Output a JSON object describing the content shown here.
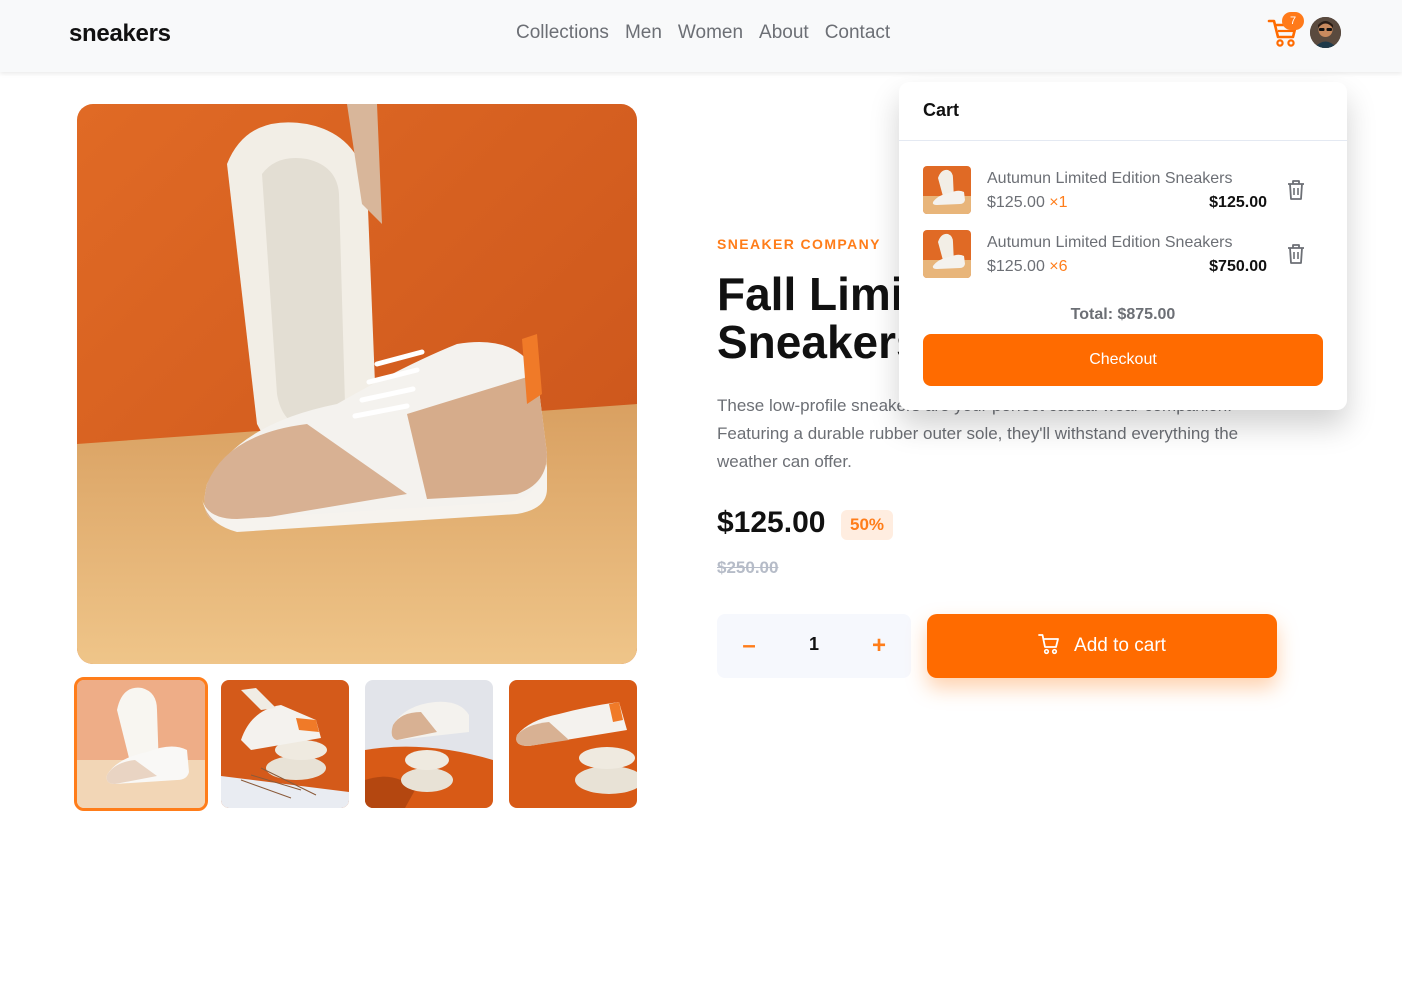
{
  "header": {
    "brand": "sneakers",
    "nav": [
      "Collections",
      "Men",
      "Women",
      "About",
      "Contact"
    ],
    "cart_count": "7"
  },
  "product": {
    "company": "SNEAKER COMPANY",
    "title": "Fall Limited Edition Sneakers",
    "description": "These low-profile sneakers are your perfect casual wear companion. Featuring a durable rubber outer sole, they'll withstand everything the weather can offer.",
    "price": "$125.00",
    "discount": "50%",
    "old_price": "$250.00",
    "quantity": "1",
    "minus_label": "–",
    "plus_label": "+",
    "add_to_cart": "Add to cart"
  },
  "cart": {
    "title": "Cart",
    "items": [
      {
        "name": "Autumun Limited Edition Sneakers",
        "unit": "$125.00",
        "qty": "×1",
        "total": "$125.00"
      },
      {
        "name": "Autumun Limited Edition Sneakers",
        "unit": "$125.00",
        "qty": "×6",
        "total": "$750.00"
      }
    ],
    "total": "Total: $875.00",
    "checkout": "Checkout"
  },
  "colors": {
    "accent": "#ff7d1a",
    "accent_dark": "#ff6b00",
    "badge_bg": "#ffede0",
    "text_muted": "#6c6f75"
  },
  "icons": [
    "cart-icon",
    "trash-icon",
    "avatar"
  ]
}
